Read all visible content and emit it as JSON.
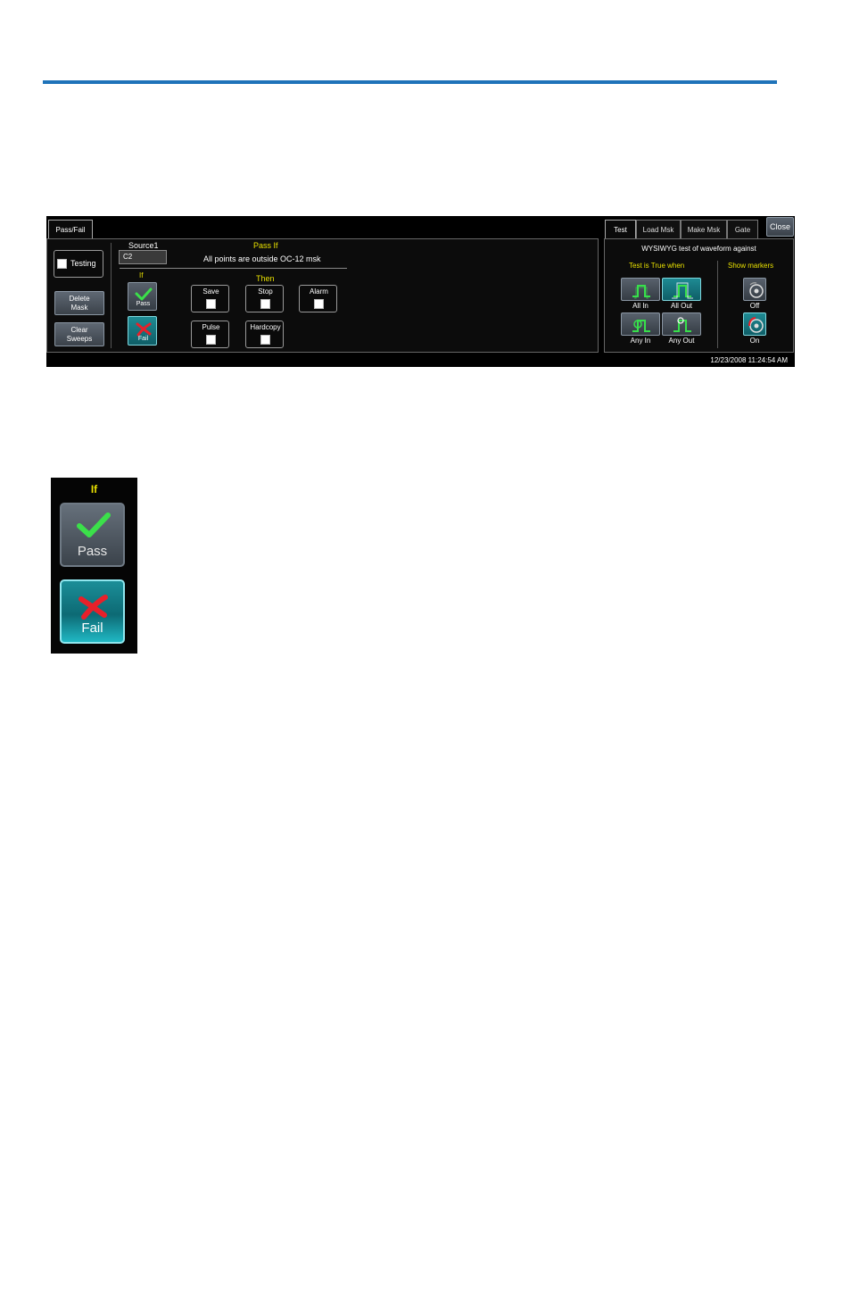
{
  "panel": {
    "tabs_left": [
      {
        "label": "Pass/Fail"
      }
    ],
    "tabs_right": [
      {
        "label": "Test"
      },
      {
        "label": "Load Msk"
      },
      {
        "label": "Make Msk"
      },
      {
        "label": "Gate"
      }
    ],
    "close_label": "Close",
    "testing_label": "Testing",
    "testing_checked": false,
    "delete_mask_label": [
      "Delete",
      "Mask"
    ],
    "clear_sweeps_label": [
      "Clear",
      "Sweeps"
    ],
    "source_label": "Source1",
    "source_value": "C2",
    "pass_if_label": "Pass If",
    "pass_if_text": "All points are outside OC-12 msk",
    "if_label": "If",
    "pass_label": "Pass",
    "fail_label": "Fail",
    "then_label": "Then",
    "actions": [
      {
        "label": "Save",
        "checked": false
      },
      {
        "label": "Stop",
        "checked": false
      },
      {
        "label": "Alarm",
        "checked": false
      },
      {
        "label": "Pulse",
        "checked": false
      },
      {
        "label": "Hardcopy",
        "checked": false
      }
    ],
    "test_description": "WYSIWYG test of waveform against",
    "test_true_when_label": "Test is True when",
    "show_markers_label": "Show markers",
    "conditions": [
      {
        "label": "All In",
        "icon": "all-in-icon",
        "selected": false
      },
      {
        "label": "All Out",
        "icon": "all-out-icon",
        "selected": true
      },
      {
        "label": "Any In",
        "icon": "any-in-icon",
        "selected": false
      },
      {
        "label": "Any Out",
        "icon": "any-out-icon",
        "selected": false
      }
    ],
    "markers": [
      {
        "label": "Off",
        "icon": "marker-off-icon",
        "selected": false
      },
      {
        "label": "On",
        "icon": "marker-on-icon",
        "selected": true
      }
    ],
    "datetime": "12/23/2008 11:24:54 AM"
  },
  "zoom": {
    "if_label": "If",
    "pass_label": "Pass",
    "fail_label": "Fail"
  },
  "colors": {
    "rule": "#1f73b9",
    "highlight_yellow": "#e8e000",
    "selected_teal": "#1b8e98",
    "waveform_green": "#37e04b",
    "fail_red": "#e8202a"
  }
}
